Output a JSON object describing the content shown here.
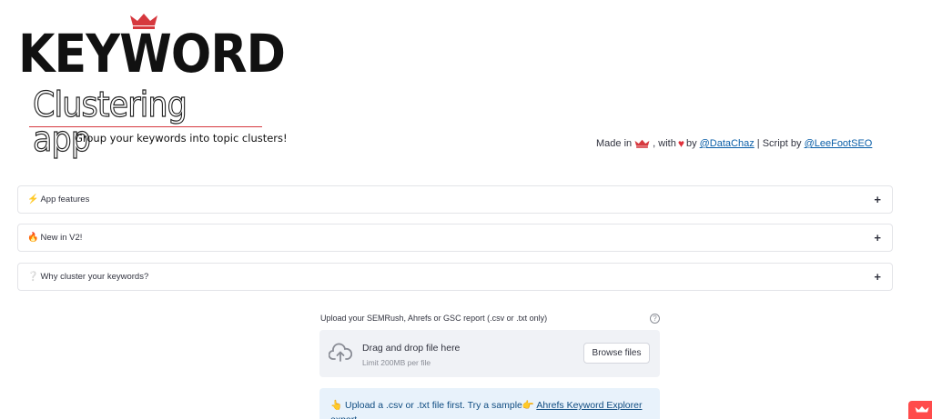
{
  "logo": {
    "title": "KEYWORD",
    "subtitle": "Clustering app",
    "tagline": "Group your keywords into topic clusters!",
    "crown_icon": "crown-icon",
    "accent": "#d6383e"
  },
  "credit": {
    "made_in": "Made in",
    "with": ", with",
    "by": "by",
    "author": "@DataChaz",
    "separator": "| Script by",
    "script_author": "@LeeFootSEO",
    "heart": "♥"
  },
  "expanders": [
    {
      "icon": "⚡",
      "label": "App features",
      "toggle": "+"
    },
    {
      "icon": "🔥",
      "label": "New in V2!",
      "toggle": "+"
    },
    {
      "icon": "❔",
      "label": "Why cluster your keywords?",
      "toggle": "+"
    }
  ],
  "uploader": {
    "label": "Upload your SEMRush, Ahrefs or GSC report (.csv or .txt only)",
    "help": "?",
    "drop_text": "Drag and drop file here",
    "limit_text": "Limit 200MB per file",
    "browse_label": "Browse files"
  },
  "info": {
    "hand_icon": "👆",
    "text": "Upload a .csv or .txt file first. Try a sample",
    "point_icon": "👉",
    "link": "Ahrefs Keyword Explorer",
    "link_cont": "export"
  },
  "colors": {
    "brand_red": "#ff4b4b",
    "link_blue": "#0b5fa8",
    "info_bg": "#e8f2fb"
  }
}
